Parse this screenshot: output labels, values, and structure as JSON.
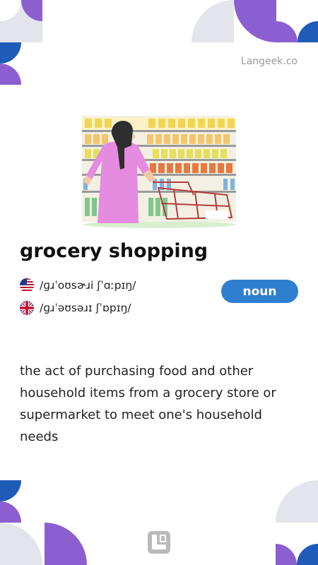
{
  "brand": {
    "site_label": "Langeek.co"
  },
  "entry": {
    "word": "grocery shopping",
    "part_of_speech": "noun",
    "pronunciations": [
      {
        "accent_icon": "us-flag-icon",
        "ipa": "/ɡɹˈoʊsɚɹi ʃˈɑːpɪŋ/"
      },
      {
        "accent_icon": "uk-flag-icon",
        "ipa": "/ɡɹˈəʊsəɹɪ ʃˈɒpɪŋ/"
      }
    ],
    "definition": "the act of purchasing food and other household items from a grocery store or supermarket to meet one's household needs",
    "illustration_icon": "woman-shopping-in-supermarket-aisle-illustration"
  },
  "colors": {
    "accent_purple": "#8c5fd1",
    "accent_blue": "#1f5bb8",
    "badge_blue": "#2f7fd0",
    "decor_grey": "#e4e5ec"
  },
  "footer": {
    "logo_icon": "langeek-logo-icon"
  }
}
